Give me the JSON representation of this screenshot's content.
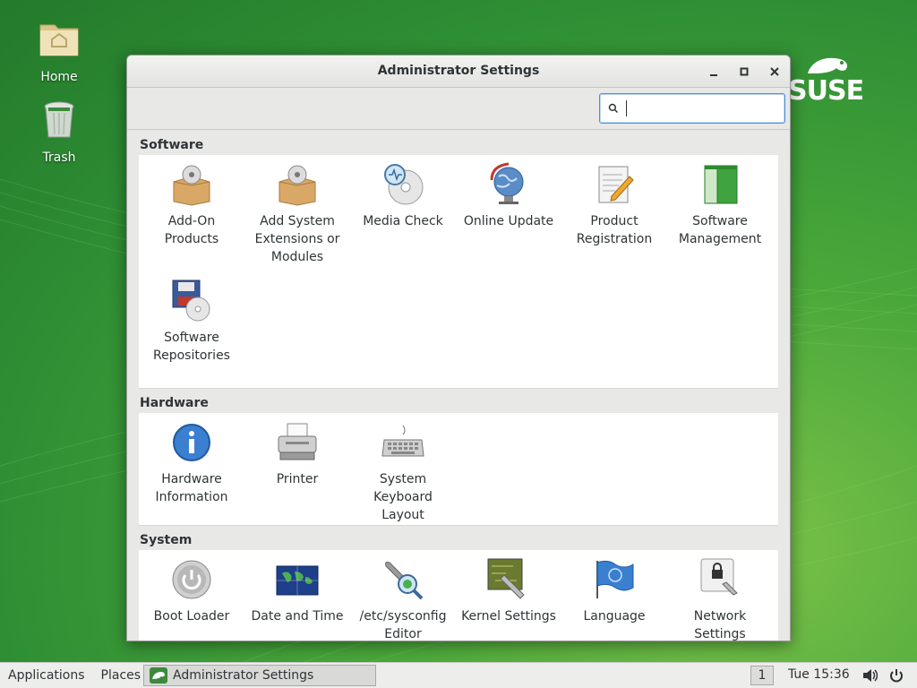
{
  "desktop": {
    "icons": [
      {
        "label": "Home"
      },
      {
        "label": "Trash"
      }
    ],
    "logo_text": "SUSE"
  },
  "window": {
    "title": "Administrator Settings",
    "search": {
      "value": "",
      "placeholder": ""
    }
  },
  "sections": {
    "software": {
      "title": "Software",
      "items": [
        {
          "label": "Add-On Products",
          "icon": "package-box-icon"
        },
        {
          "label": "Add System Extensions or Modules",
          "icon": "package-box-icon"
        },
        {
          "label": "Media Check",
          "icon": "disc-check-icon"
        },
        {
          "label": "Online Update",
          "icon": "globe-update-icon"
        },
        {
          "label": "Product Registration",
          "icon": "document-pen-icon"
        },
        {
          "label": "Software Management",
          "icon": "green-book-icon"
        },
        {
          "label": "Software Repositories",
          "icon": "floppy-disc-icon"
        }
      ]
    },
    "hardware": {
      "title": "Hardware",
      "items": [
        {
          "label": "Hardware Information",
          "icon": "info-icon"
        },
        {
          "label": "Printer",
          "icon": "printer-icon"
        },
        {
          "label": "System Keyboard Layout",
          "icon": "keyboard-icon"
        }
      ]
    },
    "system": {
      "title": "System",
      "items": [
        {
          "label": "Boot Loader",
          "icon": "power-icon"
        },
        {
          "label": "Date and Time",
          "icon": "world-map-icon"
        },
        {
          "label": "/etc/sysconfig Editor",
          "icon": "wrench-search-icon"
        },
        {
          "label": "Kernel Settings",
          "icon": "circuit-wrench-icon"
        },
        {
          "label": "Language",
          "icon": "flag-icon"
        },
        {
          "label": "Network Settings",
          "icon": "network-lock-icon"
        }
      ]
    }
  },
  "taskbar": {
    "applications": "Applications",
    "places": "Places",
    "task_label": "Administrator Settings",
    "workspace": "1",
    "clock": "Tue 15:36"
  },
  "colors": {
    "accent": "#4a90d9",
    "desktop_green": "#2f8f34"
  }
}
